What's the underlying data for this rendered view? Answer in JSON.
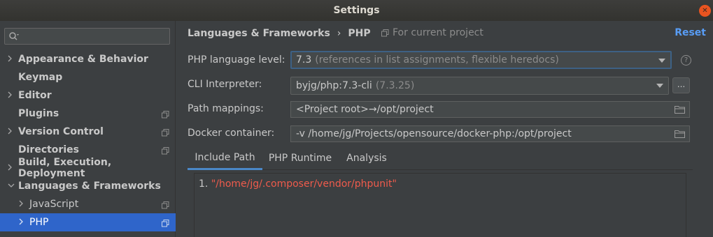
{
  "window": {
    "title": "Settings",
    "close_label": "✕"
  },
  "search": {
    "placeholder": "",
    "value": ""
  },
  "sidebar": {
    "items": [
      {
        "label": "Appearance & Behavior",
        "expandable": true,
        "project_badge": false
      },
      {
        "label": "Keymap",
        "expandable": false,
        "project_badge": false
      },
      {
        "label": "Editor",
        "expandable": true,
        "project_badge": false
      },
      {
        "label": "Plugins",
        "expandable": false,
        "project_badge": true
      },
      {
        "label": "Version Control",
        "expandable": true,
        "project_badge": true
      },
      {
        "label": "Directories",
        "expandable": false,
        "project_badge": true
      },
      {
        "label": "Build, Execution, Deployment",
        "expandable": true,
        "project_badge": false
      },
      {
        "label": "Languages & Frameworks",
        "expandable": true,
        "expanded": true,
        "project_badge": false
      },
      {
        "label": "JavaScript",
        "expandable": true,
        "project_badge": true,
        "child": true
      },
      {
        "label": "PHP",
        "expandable": true,
        "project_badge": true,
        "child": true,
        "selected": true
      }
    ]
  },
  "header": {
    "breadcrumb_parent": "Languages & Frameworks",
    "breadcrumb_separator": "›",
    "breadcrumb_current": "PHP",
    "scope_label": "For current project",
    "reset_label": "Reset"
  },
  "form": {
    "language_level": {
      "label": "PHP language level:",
      "value": "7.3",
      "hint": "(references in list assignments, flexible heredocs)"
    },
    "cli_interpreter": {
      "label": "CLI Interpreter:",
      "value": "byjg/php:7.3-cli",
      "hint": "(7.3.25)",
      "browse_label": "..."
    },
    "path_mappings": {
      "label": "Path mappings:",
      "value": "<Project root>→/opt/project"
    },
    "docker_container": {
      "label": "Docker container:",
      "value": "-v /home/jg/Projects/opensource/docker-php:/opt/project"
    },
    "help_label": "?"
  },
  "tabs": [
    {
      "label": "Include Path",
      "active": true
    },
    {
      "label": "PHP Runtime",
      "active": false
    },
    {
      "label": "Analysis",
      "active": false
    }
  ],
  "include_paths": [
    {
      "index": "1.",
      "path": "\"/home/jg/.composer/vendor/phpunit\""
    }
  ],
  "colors": {
    "selection": "#2f65ca",
    "link": "#589df6",
    "string": "#ef5b4c",
    "close_button": "#e95420"
  }
}
